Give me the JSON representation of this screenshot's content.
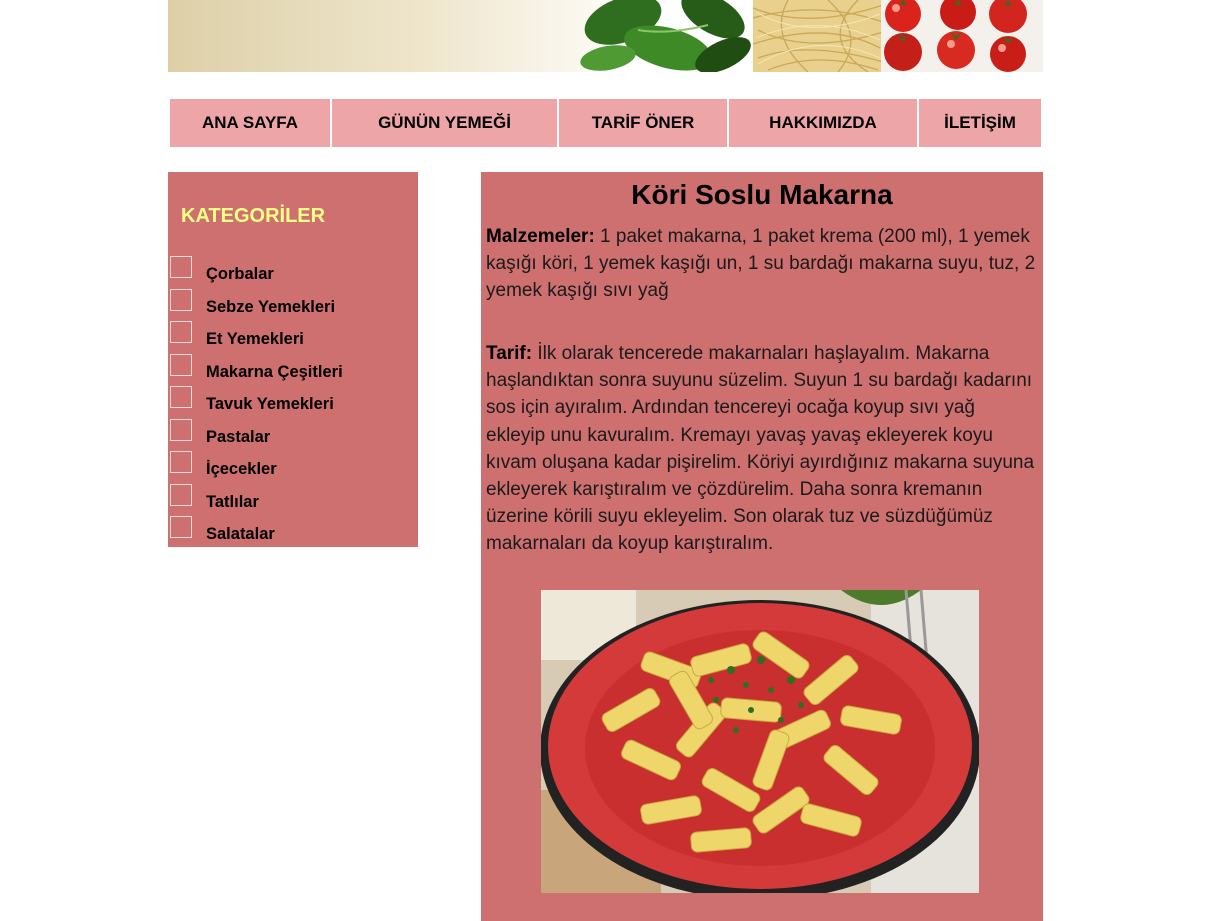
{
  "banner": {
    "image": "food-banner: basil leaves, spaghetti, cherry tomatoes"
  },
  "nav": {
    "items": [
      {
        "label": "ANA SAYFA"
      },
      {
        "label": "GÜNÜN YEMEĞİ"
      },
      {
        "label": "TARİF ÖNER"
      },
      {
        "label": "HAKKIMIZDA"
      },
      {
        "label": "İLETİŞİM"
      }
    ]
  },
  "sidebar": {
    "title": "KATEGORİLER",
    "categories": [
      {
        "label": "Çorbalar",
        "checked": false
      },
      {
        "label": "Sebze Yemekleri",
        "checked": false
      },
      {
        "label": "Et Yemekleri",
        "checked": false
      },
      {
        "label": "Makarna Çeşitleri",
        "checked": false
      },
      {
        "label": "Tavuk Yemekleri",
        "checked": false
      },
      {
        "label": "Pastalar",
        "checked": false
      },
      {
        "label": "İçecekler",
        "checked": false
      },
      {
        "label": "Tatlılar",
        "checked": false
      },
      {
        "label": "Salatalar",
        "checked": false
      }
    ]
  },
  "recipe": {
    "title": "Köri Soslu Makarna",
    "ingredients_label": "Malzemeler:",
    "ingredients_text": " 1 paket makarna, 1 paket krema (200 ml), 1 yemek kaşığı köri, 1 yemek kaşığı un, 1 su bardağı makarna suyu, tuz, 2 yemek kaşığı sıvı yağ",
    "method_label": "Tarif:",
    "method_text": " İlk olarak tencerede makarnaları haşlayalım. Makarna haşlandıktan sonra suyunu süzelim. Suyun 1 su bardağı kadarını sos için ayıralım. Ardından tencereyi ocağa koyup sıvı yağ ekleyip unu kavuralım. Kremayı yavaş yavaş ekleyerek koyu kıvam oluşana kadar pişirelim. Köriyi ayırdığınız makarna suyuna ekleyerek karıştıralım ve çözdürelim. Daha sonra kremanın üzerine körili suyu ekleyelim. Son olarak tuz ve süzdüğümüz makarnaları da koyup karıştıralım.",
    "image": "penne-curry-plate-photo"
  },
  "colors": {
    "nav_bg": "#eea5a7",
    "panel_bg": "#cd706f",
    "sidebar_title": "#ffff88"
  }
}
